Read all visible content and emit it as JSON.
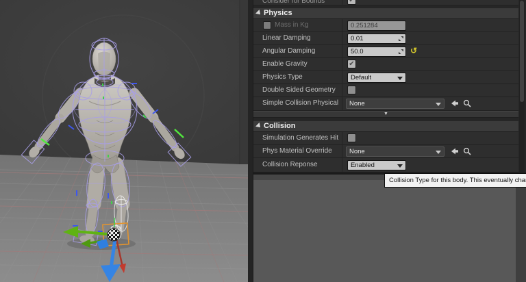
{
  "icons": {
    "check": "✔",
    "reset": "↺",
    "expander_caret": "▼"
  },
  "viewport": {
    "content": "UE mannequin physics asset preview",
    "colors": {
      "wireframe": "#a99fe8",
      "selected_wireframe": "#ececec",
      "gizmo_x_axis": "#c23b2e",
      "gizmo_y_axis": "#5fb312",
      "gizmo_z_axis": "#3584e4",
      "selection_box": "#e6952c"
    }
  },
  "panel": {
    "partial_row": {
      "label": "Consider for Bounds",
      "checked": true
    },
    "sections": {
      "physics": {
        "title": "Physics",
        "rows": {
          "mass": {
            "label": "Mass in Kg",
            "value": "0.251284",
            "enabled": false
          },
          "linear_damping": {
            "label": "Linear Damping",
            "value": "0.01"
          },
          "angular_damping": {
            "label": "Angular Damping",
            "value": "50.0"
          },
          "enable_gravity": {
            "label": "Enable Gravity",
            "checked": true
          },
          "physics_type": {
            "label": "Physics Type",
            "value": "Default"
          },
          "double_sided": {
            "label": "Double Sided Geometry",
            "checked": false
          },
          "simple_collision": {
            "label": "Simple Collision Physical Ma",
            "value": "None"
          }
        }
      },
      "collision": {
        "title": "Collision",
        "rows": {
          "sim_hit": {
            "label": "Simulation Generates Hit Eve",
            "checked": false
          },
          "phys_material": {
            "label": "Phys Material Override",
            "value": "None"
          },
          "collision_response": {
            "label": "Collision Reponse",
            "value": "Enabled"
          }
        }
      }
    },
    "tooltip": "Collision Type for this body. This eventually chang"
  }
}
